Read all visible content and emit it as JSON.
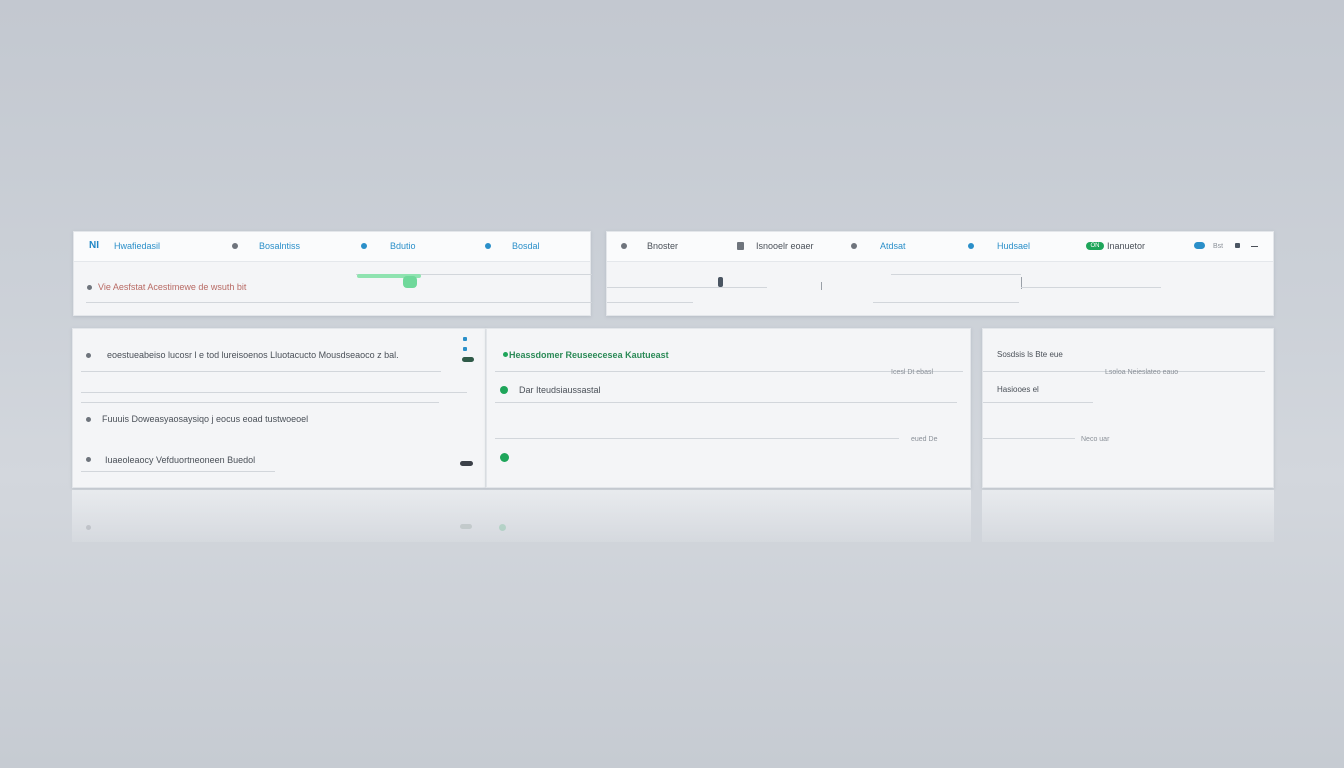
{
  "toolbar_left": {
    "logo": "NI",
    "app_title": "Hwafiedasil",
    "nav_items": [
      {
        "label": "Bosalntiss",
        "icon": "location-pin-icon"
      },
      {
        "label": "Bdutio",
        "icon": "location-pin-icon"
      },
      {
        "label": "Bosdal",
        "icon": "location-pin-icon"
      }
    ],
    "search_text": "Vie Aesfstat Acestimewe de wsuth bit"
  },
  "toolbar_right": {
    "items": [
      {
        "label": "Bnoster",
        "icon": "location-pin-icon"
      },
      {
        "label": "Isnooelr eoaer",
        "icon": "document-icon"
      },
      {
        "label": "Atdsat",
        "icon": "location-pin-icon"
      },
      {
        "label": "Hudsael",
        "icon": "location-pin-icon"
      }
    ],
    "status_label": "Inanuetor",
    "status_badge": "ON",
    "window_label": "Bst"
  },
  "list_panel": {
    "items": [
      {
        "label": "eoestueabeiso lucosr l e tod lureisoenos Lluotacucto Mousdseaoco z bal."
      },
      {
        "label": "Fuuuis Doweasyaosaysiqo j eocus eoad tustwoeoel"
      },
      {
        "label": "Iuaeoleaocy Vefduortneoneen Buedol"
      }
    ]
  },
  "detail_panel": {
    "heading": "Heassdomer Reuseecesea Kautueast",
    "sub_item": "Dar Iteudsiaussastal",
    "meta_1": "Icesl Dt ebasl",
    "meta_2": "eued De"
  },
  "side_panel": {
    "title": "Sosdsis ls Bte eue",
    "subtitle": "Hasiooes el",
    "meta_1": "Lsoloa  Neieslateo  eauo",
    "meta_2": "Neco uar"
  },
  "colors": {
    "accent_blue": "#2a8fc9",
    "accent_green": "#1ea55a",
    "accent_red": "#b86a64"
  }
}
